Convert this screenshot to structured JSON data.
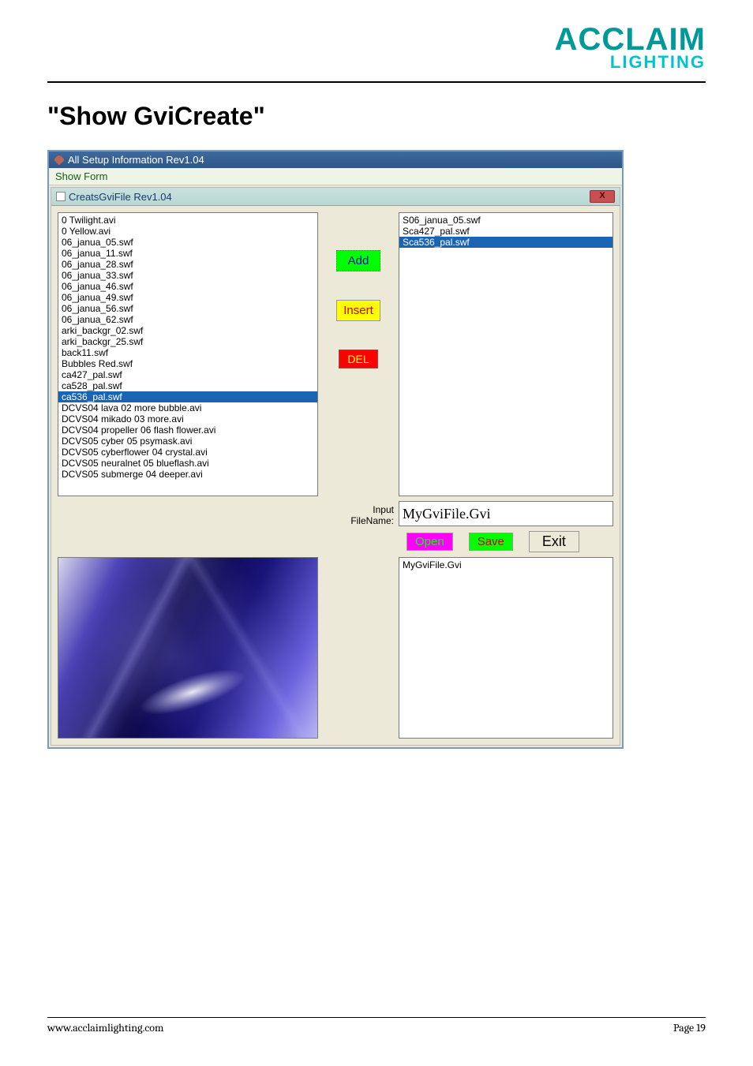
{
  "logo": {
    "line1": "ACCLAIM",
    "line2": "LIGHTING"
  },
  "heading": "\"Show GviCreate\"",
  "outer": {
    "title": "All Setup Information Rev1.04",
    "menu": "Show Form"
  },
  "inner": {
    "title": "CreatsGviFile Rev1.04",
    "close": "X"
  },
  "left_list": {
    "items": [
      "0 Twilight.avi",
      "0 Yellow.avi",
      "06_janua_05.swf",
      "06_janua_11.swf",
      "06_janua_28.swf",
      "06_janua_33.swf",
      "06_janua_46.swf",
      "06_janua_49.swf",
      "06_janua_56.swf",
      "06_janua_62.swf",
      "arki_backgr_02.swf",
      "arki_backgr_25.swf",
      "back11.swf",
      "Bubbles Red.swf",
      "ca427_pal.swf",
      "ca528_pal.swf",
      "ca536_pal.swf",
      "DCVS04 lava 02 more bubble.avi",
      "DCVS04 mikado 03 more.avi",
      "DCVS04 propeller 06 flash flower.avi",
      "DCVS05 cyber 05 psymask.avi",
      "DCVS05 cyberflower 04 crystal.avi",
      "DCVS05 neuralnet 05 blueflash.avi",
      "DCVS05 submerge 04 deeper.avi"
    ],
    "selected_index": 16
  },
  "mid_buttons": {
    "add": "Add",
    "insert": "Insert",
    "del": "DEL"
  },
  "right_list": {
    "items": [
      "S06_janua_05.swf",
      "Sca427_pal.swf",
      "Sca536_pal.swf"
    ],
    "selected_index": 2
  },
  "filename": {
    "label": "Input\nFileName:",
    "value": "MyGviFile.Gvi"
  },
  "actions": {
    "open": "Open",
    "save": "Save",
    "exit": "Exit"
  },
  "saved_list": {
    "items": [
      "MyGviFile.Gvi"
    ]
  },
  "footer": {
    "left": "www.acclaimlighting.com",
    "right": "Page 19"
  }
}
